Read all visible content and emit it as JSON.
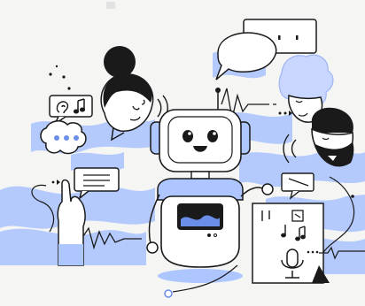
{
  "scene": {
    "background": "#f5f5f4",
    "accent": "#aec6ff",
    "ink": "#1a1a1a",
    "robot_face": "#ffffff",
    "robot_eye": "#1a1a1a",
    "elements": [
      "robot",
      "woman-with-bun",
      "curly-haired-person",
      "bearded-man",
      "speech-bubbles",
      "sound-waves",
      "microphone",
      "music-notes",
      "hand"
    ]
  }
}
